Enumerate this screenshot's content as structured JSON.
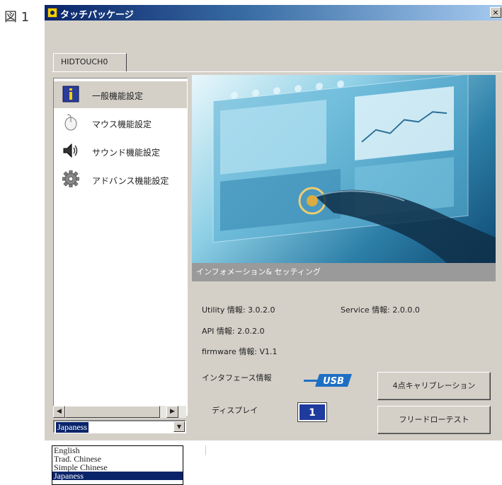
{
  "figure_label": "図 1",
  "window": {
    "title": "タッチパッケージ",
    "close_glyph": "×"
  },
  "tab": {
    "label": "HIDTOUCH0"
  },
  "sidebar": {
    "items": [
      {
        "label": "一般機能設定",
        "icon": "info-icon",
        "selected": true
      },
      {
        "label": "マウス機能設定",
        "icon": "mouse-icon",
        "selected": false
      },
      {
        "label": "サウンド機能設定",
        "icon": "speaker-icon",
        "selected": false
      },
      {
        "label": "アドバンス機能設定",
        "icon": "gear-icon",
        "selected": false
      }
    ],
    "scroll_left": "◀",
    "scroll_right": "▶"
  },
  "language": {
    "selected": "Japaness",
    "dropdown_glyph": "▼",
    "options": [
      "English",
      "Trad. Chinese",
      "Simple Chinese",
      "Japaness"
    ]
  },
  "banner": {
    "caption": "インフォメーション& セッティング"
  },
  "info": {
    "utility": "Utility 情報: 3.0.2.0",
    "service": "Service 情報: 2.0.0.0",
    "api": "API 情報: 2.0.2.0",
    "firmware": "firmware 情報: V1.1",
    "interface_label": "インタフェース情報",
    "interface_value": "USB",
    "display_label": "ディスプレイ",
    "display_value": "1"
  },
  "buttons": {
    "calibration": "4点キャリブレーション",
    "free_draw": "フリードローテスト"
  },
  "colors": {
    "title_bar": "#0a246a",
    "selection": "#0a246a",
    "display_box": "#1f3b9e",
    "usb_logo": "#1e6fc4"
  }
}
